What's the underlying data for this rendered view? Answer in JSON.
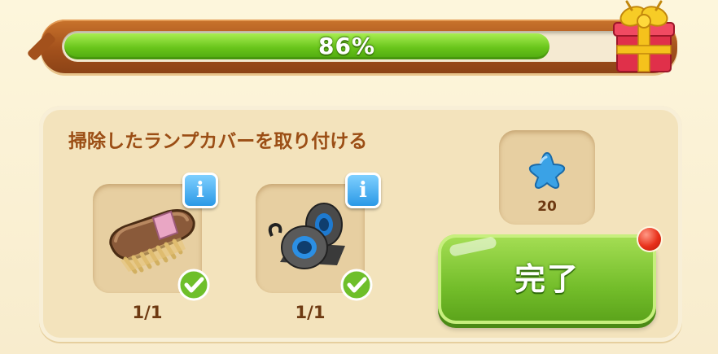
{
  "progress": {
    "value": 0.86,
    "label": "86%"
  },
  "gift": {
    "icon": "gift-box-icon"
  },
  "quest": {
    "title": "掃除したランプカバーを取り付ける",
    "items": [
      {
        "name": "scrub-brush",
        "icon": "brush-icon",
        "count": "1/1",
        "completed": true
      },
      {
        "name": "duct-tape",
        "icon": "tape-roll-icon",
        "count": "1/1",
        "completed": true
      }
    ],
    "reward": {
      "icon": "blue-star-icon",
      "amount": "20"
    },
    "complete_button": {
      "label": "完了"
    }
  },
  "colors": {
    "progress_fill": "#69c51b",
    "title_text": "#9b4e15",
    "info_button": "#2b99e6",
    "complete_button": "#73bd2a",
    "notification": "#e8301a"
  }
}
